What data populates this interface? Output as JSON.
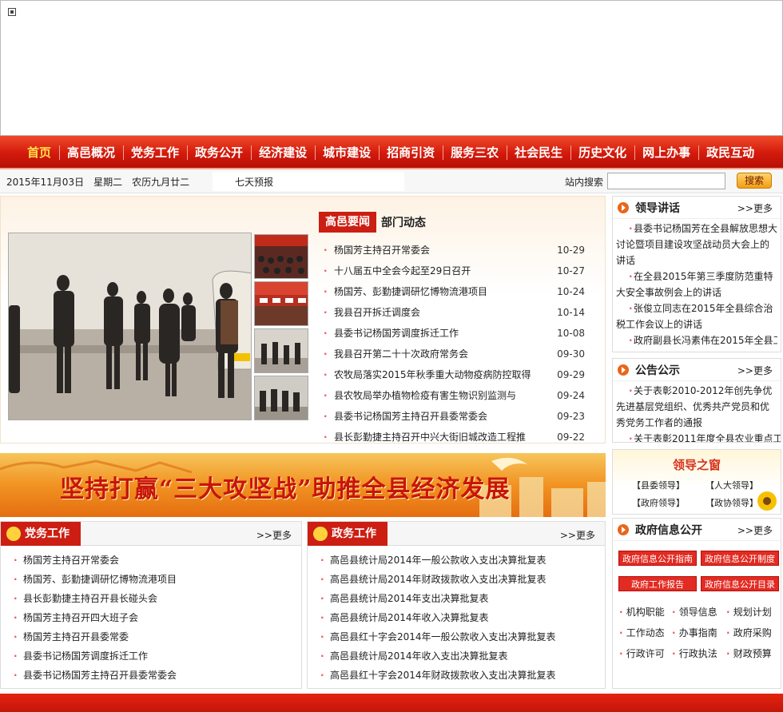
{
  "nav": {
    "items": [
      "首页",
      "高邑概况",
      "党务工作",
      "政务公开",
      "经济建设",
      "城市建设",
      "招商引资",
      "服务三农",
      "社会民生",
      "历史文化",
      "网上办事",
      "政民互动"
    ]
  },
  "infobar": {
    "date": "2015年11月03日　星期二　农历九月廿二",
    "weather": "七天预报",
    "search_label": "站内搜索",
    "search_placeholder": "",
    "search_button": "搜索"
  },
  "news": {
    "tab_active": "高邑要闻",
    "tab_other": "部门动态",
    "items": [
      {
        "title": "杨国芳主持召开常委会",
        "date": "10-29"
      },
      {
        "title": "十八届五中全会今起至29日召开",
        "date": "10-27"
      },
      {
        "title": "杨国芳、彭勤捷调研忆博物流港项目",
        "date": "10-24"
      },
      {
        "title": "我县召开拆迁调度会",
        "date": "10-14"
      },
      {
        "title": "县委书记杨国芳调度拆迁工作",
        "date": "10-08"
      },
      {
        "title": "我县召开第二十十次政府常务会",
        "date": "09-30"
      },
      {
        "title": "农牧局落实2015年秋季重大动物疫病防控取得",
        "date": "09-29"
      },
      {
        "title": "县农牧局举办植物检疫有害生物识别监测与",
        "date": "09-24"
      },
      {
        "title": "县委书记杨国芳主持召开县委常委会",
        "date": "09-23"
      },
      {
        "title": "县长彭勤捷主持召开中兴大街旧城改造工程推",
        "date": "09-22"
      }
    ]
  },
  "slogan": "坚持打赢“三大攻坚战”助推全县经济发展",
  "party": {
    "title": "党务工作",
    "more": ">>更多",
    "items": [
      "杨国芳主持召开常委会",
      "杨国芳、彭勤捷调研忆博物流港项目",
      "县长彭勤捷主持召开县长碰头会",
      "杨国芳主持召开四大班子会",
      "杨国芳主持召开县委常委",
      "县委书记杨国芳调度拆迁工作",
      "县委书记杨国芳主持召开县委常委会"
    ]
  },
  "gov": {
    "title": "政务工作",
    "more": ">>更多",
    "items": [
      "高邑县统计局2014年一般公款收入支出决算批复表",
      "高邑县统计局2014年财政拨款收入支出决算批复表",
      "高邑县统计局2014年支出决算批复表",
      "高邑县统计局2014年收入决算批复表",
      "高邑县红十字会2014年一般公款收入支出决算批复表",
      "高邑县统计局2014年收入支出决算批复表",
      "高邑县红十字会2014年财政拨款收入支出决算批复表"
    ]
  },
  "speeches": {
    "title": "领导讲话",
    "more": ">>更多",
    "items": [
      "县委书记杨国芳在全县解放思想大讨论暨项目建设攻坚战动员大会上的讲话",
      "在全县2015年第三季度防范重特大安全事故例会上的讲话",
      "张俊立同志在2015年全县综合治税工作会议上的讲话",
      "政府副县长冯素伟在2015年全县工"
    ]
  },
  "notices": {
    "title": "公告公示",
    "more": ">>更多",
    "items": [
      "关于表彰2010-2012年创先争优先进基层党组织、优秀共产党员和优秀党务工作者的通报",
      "关于表彰2011年度全县农业重点工"
    ]
  },
  "leaders": {
    "title": "领导之窗",
    "links": [
      "【县委领导】",
      "【人大领导】",
      "【政府领导】",
      "【政协领导】"
    ]
  },
  "govinfo": {
    "title": "政府信息公开",
    "more": ">>更多",
    "buttons": [
      "政府信息公开指南",
      "政府信息公开制度",
      "政府工作报告",
      "政府信息公开目录"
    ],
    "links": [
      "机构职能",
      "领导信息",
      "规划计划",
      "工作动态",
      "办事指南",
      "政府采购",
      "行政许可",
      "行政执法",
      "财政预算"
    ]
  }
}
